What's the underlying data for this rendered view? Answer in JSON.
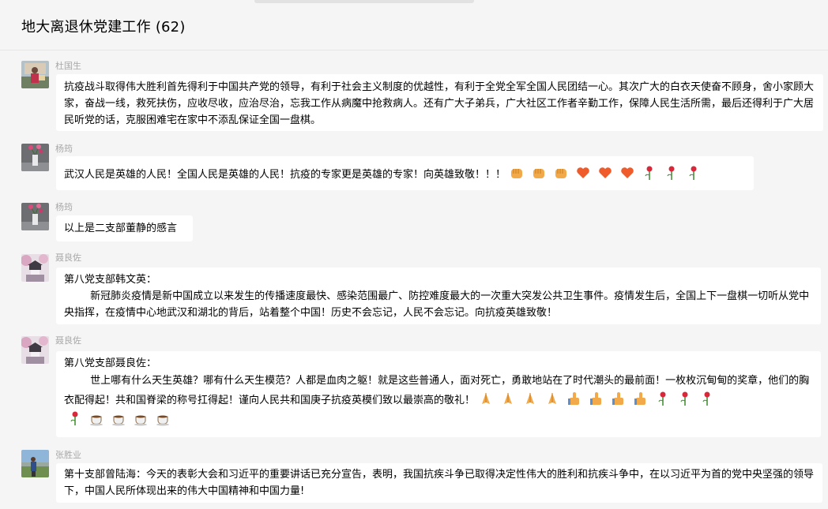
{
  "chat": {
    "title": "地大离退休党建工作",
    "member_count": "(62)"
  },
  "messages": [
    {
      "sender": "杜国生",
      "avatar": "person-photo-avatar",
      "text": "抗疫战斗取得伟大胜利首先得利于中国共产党的领导，有利于社会主义制度的优越性，有利于全党全军全国人民团结一心。其次广大的白衣天使奋不顾身，舍小家顾大家，奋战一线，救死扶伤，应收尽收，应治尽治，忘我工作从病魔中抢救病人。还有广大子弟兵，广大社区工作者辛勤工作，保障人民生活所需，最后还得利于广大居民听党的话，克服困难宅在家中不添乱保证全国一盘棋。"
    },
    {
      "sender": "杨筠",
      "avatar": "flower-vase-avatar",
      "text": "武汉人民是英雄的人民！全国人民是英雄的人民！抗疫的专家更是英雄的专家！向英雄致敬！！！",
      "emojis": [
        "fist-icon",
        "fist-icon",
        "fist-icon",
        "heart-icon",
        "heart-icon",
        "heart-icon",
        "rose-icon",
        "rose-icon",
        "rose-icon"
      ]
    },
    {
      "sender": "杨筠",
      "avatar": "flower-vase-avatar",
      "text": "以上是二支部董静的感言"
    },
    {
      "sender": "聂良佐",
      "avatar": "castle-blossom-avatar",
      "line1": "第八党支部韩文英：",
      "text": "        新冠肺炎疫情是新中国成立以来发生的传播速度最快、感染范围最广、防控难度最大的一次重大突发公共卫生事件。疫情发生后，全国上下一盘棋一切听从党中央指挥，在疫情中心地武汉和湖北的背后，站着整个中国！历史不会忘记，人民不会忘记。向抗疫英雄致敬！"
    },
    {
      "sender": "聂良佐",
      "avatar": "castle-blossom-avatar",
      "line1": "第八党支部聂良佐：",
      "text": "        世上哪有什么天生英雄？哪有什么天生模范？人都是血肉之躯！就是这些普通人，面对死亡，勇敢地站在了时代潮头的最前面！一枚枚沉甸甸的奖章，他们的胸衣配得起！共和国脊梁的称号扛得起！谨向人民共和国庚子抗疫英模们致以最崇高的敬礼！",
      "emojis": [
        "pray-icon",
        "pray-icon",
        "pray-icon",
        "pray-icon",
        "thumbs-up-icon",
        "thumbs-up-icon",
        "thumbs-up-icon",
        "thumbs-up-icon",
        "rose-icon",
        "rose-icon",
        "rose-icon",
        "rose-icon",
        "coffee-icon",
        "coffee-icon",
        "coffee-icon",
        "coffee-icon"
      ]
    },
    {
      "sender": "张胜业",
      "avatar": "person-outdoor-avatar",
      "text": "第十支部曾陆海：今天的表彰大会和习近平的重要讲话已充分宣告，表明，我国抗疾斗争已取得决定性伟大的胜利和抗疾斗争中，在以习近平为首的党中央坚强的领导下，中国人民所体现出来的伟大中国精神和中国力量!"
    }
  ],
  "colors": {
    "background": "#f5f5f5",
    "bubble": "#ffffff",
    "sender_name": "#a8a8a8"
  }
}
